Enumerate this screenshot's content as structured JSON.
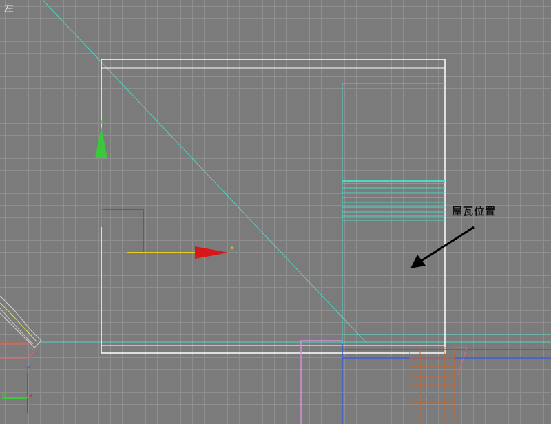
{
  "viewport": {
    "label": "左",
    "annotation": "屋瓦位置",
    "gizmo": {
      "x_axis_label": "x",
      "y_axis_label": "y",
      "x_color": "#e8d020",
      "y_color": "#3cc83c",
      "z_color": "#c82828"
    },
    "corner_gizmo": {
      "x_axis_label": "x",
      "y_axis_label": "y",
      "z_axis_label": "z"
    },
    "colors": {
      "background": "#7b7b7b",
      "grid": "#8e8e8e",
      "selection_box": "#ffffff",
      "cyan_lines": "#4fd6c4",
      "blue_lines": "#3a5ad8",
      "pink_lines": "#d890d8",
      "orange_lines": "#c8642a"
    }
  }
}
